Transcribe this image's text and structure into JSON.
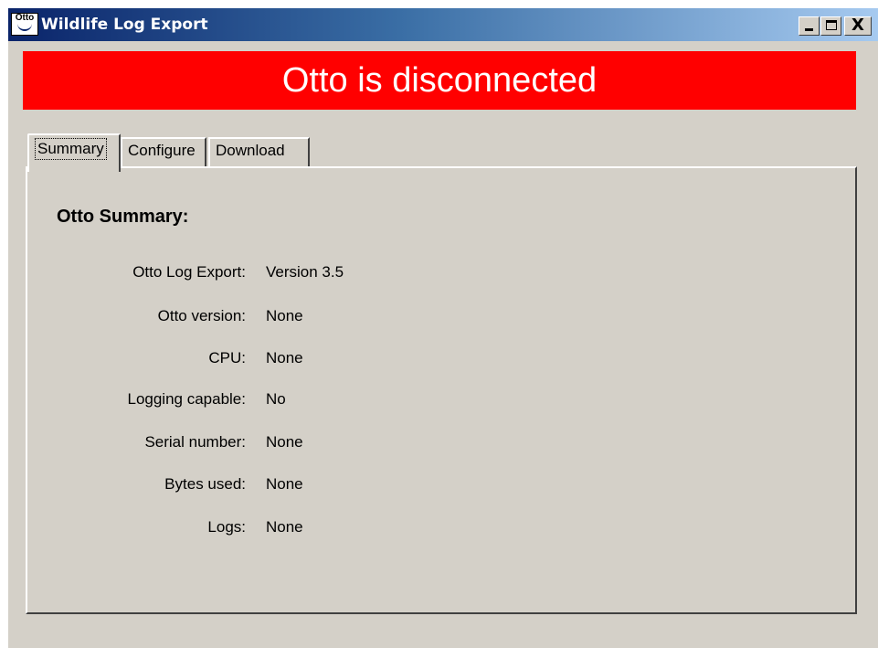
{
  "window": {
    "title": "Wildlife Log Export",
    "icon_text": "Otto",
    "controls": {
      "minimize": "minimize-icon",
      "maximize": "maximize-icon",
      "close_label": "X"
    }
  },
  "banner": {
    "text": "Otto is disconnected",
    "background": "#ff0000",
    "color": "#ffffff"
  },
  "tabs": [
    {
      "label": "Summary",
      "active": true
    },
    {
      "label": "Configure",
      "active": false
    },
    {
      "label": "Download",
      "active": false
    }
  ],
  "summary": {
    "heading": "Otto Summary:",
    "rows": [
      {
        "label": "Otto Log Export:",
        "value": "Version 3.5"
      },
      {
        "label": "Otto version:",
        "value": "None"
      },
      {
        "label": "CPU:",
        "value": "None"
      },
      {
        "label": "Logging capable:",
        "value": "No"
      },
      {
        "label": "Serial number:",
        "value": "None"
      },
      {
        "label": "Bytes used:",
        "value": "None"
      },
      {
        "label": "Logs:",
        "value": "None"
      }
    ]
  }
}
